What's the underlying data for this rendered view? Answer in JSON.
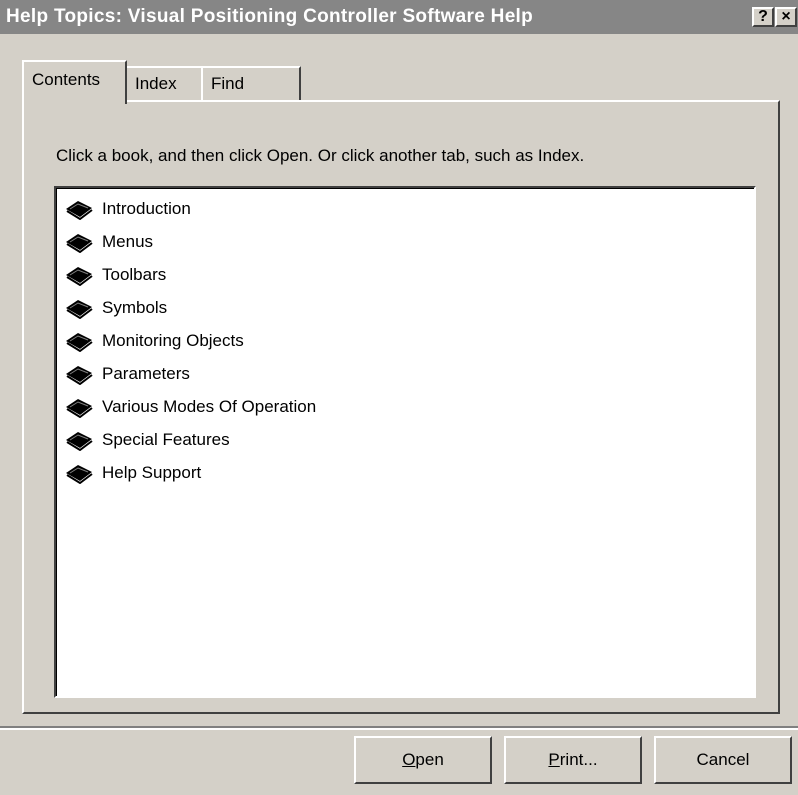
{
  "window": {
    "title": "Help Topics: Visual Positioning Controller Software Help",
    "help_button": "?",
    "close_button": "×"
  },
  "tabs": [
    {
      "label": "Contents",
      "active": true
    },
    {
      "label": "Index",
      "active": false
    },
    {
      "label": "Find",
      "active": false
    }
  ],
  "contents": {
    "instruction": "Click a book, and then click Open. Or click another tab, such as Index.",
    "items": [
      {
        "label": "Introduction",
        "icon": "book-icon"
      },
      {
        "label": "Menus",
        "icon": "book-icon"
      },
      {
        "label": "Toolbars",
        "icon": "book-icon"
      },
      {
        "label": "Symbols",
        "icon": "book-icon"
      },
      {
        "label": "Monitoring Objects",
        "icon": "book-icon"
      },
      {
        "label": "Parameters",
        "icon": "book-icon"
      },
      {
        "label": "Various Modes Of Operation",
        "icon": "book-icon"
      },
      {
        "label": "Special Features",
        "icon": "book-icon"
      },
      {
        "label": "Help Support",
        "icon": "book-icon"
      }
    ]
  },
  "buttons": {
    "open": {
      "mnemonic": "O",
      "rest": "pen"
    },
    "print": {
      "mnemonic": "P",
      "rest": "rint..."
    },
    "cancel": {
      "label": "Cancel"
    }
  },
  "colors": {
    "title_bar": "#868686",
    "face": "#d4d0c8",
    "list_background": "#ffffff"
  }
}
